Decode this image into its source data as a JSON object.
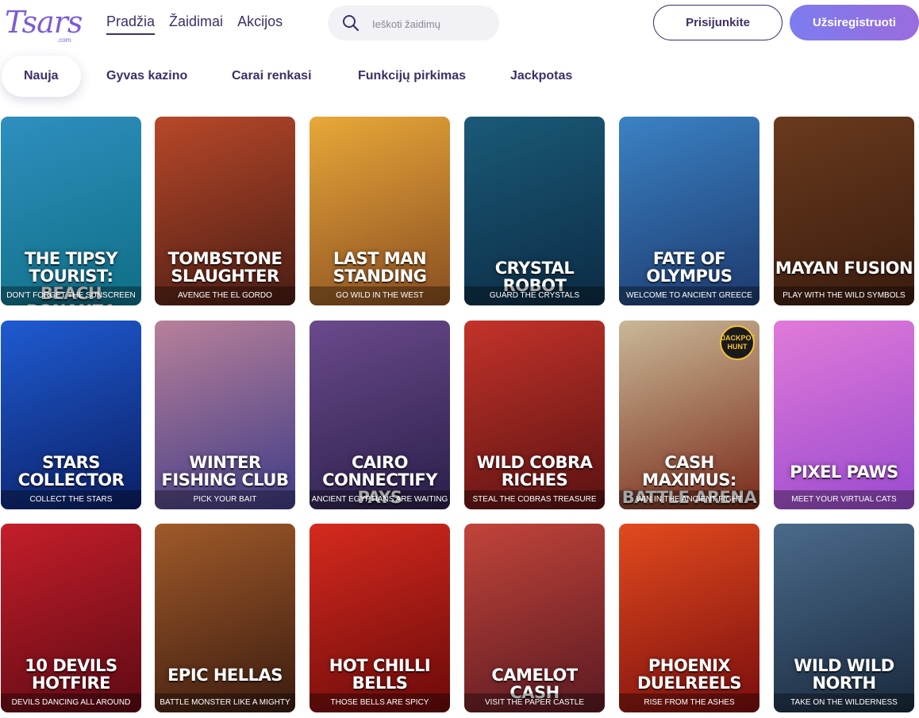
{
  "brand": {
    "logo": "Tsars",
    "logo_sub": ".com"
  },
  "nav": [
    {
      "label": "Pradžia",
      "active": true
    },
    {
      "label": "Žaidimai",
      "active": false
    },
    {
      "label": "Akcijos",
      "active": false
    }
  ],
  "search": {
    "placeholder": "Ieškoti žaidimų",
    "value": ""
  },
  "auth": {
    "login_label": "Prisijunkite",
    "register_label": "Užsiregistruoti"
  },
  "tabs": [
    {
      "label": "Nauja",
      "active": true
    },
    {
      "label": "Gyvas kazino",
      "active": false
    },
    {
      "label": "Carai renkasi",
      "active": false
    },
    {
      "label": "Funkcijų pirkimas",
      "active": false
    },
    {
      "label": "Jackpotas",
      "active": false
    }
  ],
  "games": [
    {
      "title": "THE TIPSY TOURIST: BEACH BONANZA",
      "subtitle": "DON'T FORGET THE SUNSCREEN",
      "colors": [
        "#2f8fbf",
        "#0f6f86"
      ],
      "badge": ""
    },
    {
      "title": "TOMBSTONE SLAUGHTER",
      "subtitle": "AVENGE THE EL GORDO",
      "colors": [
        "#b8482a",
        "#4a1d14"
      ],
      "badge": ""
    },
    {
      "title": "LAST MAN STANDING",
      "subtitle": "GO WILD IN THE WEST",
      "colors": [
        "#e8a838",
        "#8a4e22"
      ],
      "badge": ""
    },
    {
      "title": "CRYSTAL ROBOT",
      "subtitle": "GUARD THE CRYSTALS",
      "colors": [
        "#1a5a78",
        "#0c2b44"
      ],
      "badge": ""
    },
    {
      "title": "FATE OF OLYMPUS",
      "subtitle": "WELCOME TO ANCIENT GREECE",
      "colors": [
        "#3b82c4",
        "#1d3a6e"
      ],
      "badge": ""
    },
    {
      "title": "MAYAN FUSION",
      "subtitle": "PLAY WITH THE WILD SYMBOLS",
      "colors": [
        "#6a3a1e",
        "#3a1c0e"
      ],
      "badge": ""
    },
    {
      "title": "STARS COLLECTOR",
      "subtitle": "COLLECT THE STARS",
      "colors": [
        "#1f5bd1",
        "#0b1f66"
      ],
      "badge": ""
    },
    {
      "title": "WINTER FISHING CLUB",
      "subtitle": "PICK YOUR BAIT",
      "colors": [
        "#b8809a",
        "#3f3c86"
      ],
      "badge": ""
    },
    {
      "title": "CAIRO CONNECTIFY PAYS",
      "subtitle": "ANCIENT EGYPTIANS ARE WAITING",
      "colors": [
        "#6a4a8c",
        "#2a1f4a"
      ],
      "badge": ""
    },
    {
      "title": "WILD COBRA RICHES",
      "subtitle": "STEAL THE COBRAS TREASURE",
      "colors": [
        "#c4332a",
        "#5a1212"
      ],
      "badge": ""
    },
    {
      "title": "CASH MAXIMUS: BATTLE ARENA",
      "subtitle": "WIN IN THE ANCIENT FIGHT",
      "colors": [
        "#c9b898",
        "#7a2a1a"
      ],
      "badge": "JACKPOT HUNT"
    },
    {
      "title": "PIXEL PAWS",
      "subtitle": "MEET YOUR VIRTUAL CATS",
      "colors": [
        "#e07ad8",
        "#9a4ad0"
      ],
      "badge": ""
    },
    {
      "title": "10 DEVILS HOTFIRE",
      "subtitle": "DEVILS DANCING ALL AROUND",
      "colors": [
        "#c41e2a",
        "#5e0a14"
      ],
      "badge": ""
    },
    {
      "title": "EPIC HELLAS",
      "subtitle": "BATTLE MONSTER LIKE A MIGHTY",
      "colors": [
        "#a05a2a",
        "#3c1c10"
      ],
      "badge": ""
    },
    {
      "title": "HOT CHILLI BELLS",
      "subtitle": "THOSE BELLS ARE SPICY",
      "colors": [
        "#d62a1e",
        "#6a0a0a"
      ],
      "badge": ""
    },
    {
      "title": "CAMELOT CASH",
      "subtitle": "VISIT THE PAPER CASTLE",
      "colors": [
        "#c2443a",
        "#5a1a22"
      ],
      "badge": ""
    },
    {
      "title": "PHOENIX DUELREELS",
      "subtitle": "RISE FROM THE ASHES",
      "colors": [
        "#e24a1e",
        "#7a0e0e"
      ],
      "badge": ""
    },
    {
      "title": "WILD WILD NORTH",
      "subtitle": "TAKE ON THE WILDERNESS",
      "colors": [
        "#4a6a8a",
        "#1a2a3e"
      ],
      "badge": ""
    }
  ]
}
